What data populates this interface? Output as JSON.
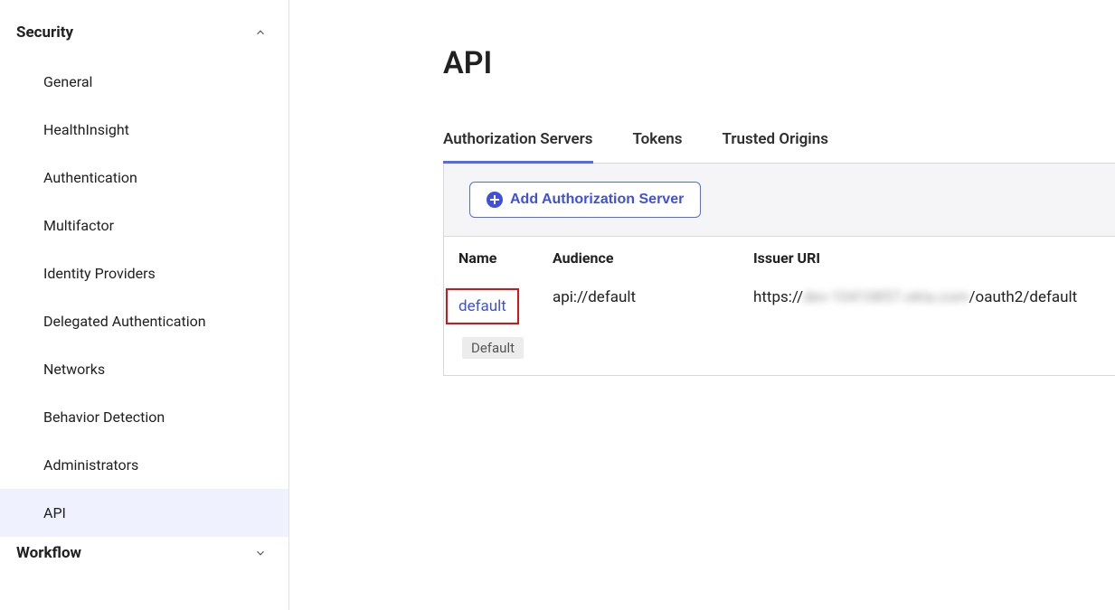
{
  "sidebar": {
    "sections": [
      {
        "label": "Security",
        "expanded": true,
        "items": [
          {
            "label": "General"
          },
          {
            "label": "HealthInsight"
          },
          {
            "label": "Authentication"
          },
          {
            "label": "Multifactor"
          },
          {
            "label": "Identity Providers"
          },
          {
            "label": "Delegated Authentication"
          },
          {
            "label": "Networks"
          },
          {
            "label": "Behavior Detection"
          },
          {
            "label": "Administrators"
          },
          {
            "label": "API",
            "active": true
          }
        ]
      },
      {
        "label": "Workflow",
        "expanded": false
      }
    ]
  },
  "page": {
    "title": "API",
    "tabs": [
      {
        "label": "Authorization Servers",
        "active": true
      },
      {
        "label": "Tokens"
      },
      {
        "label": "Trusted Origins"
      }
    ],
    "add_button_label": "Add Authorization Server",
    "table": {
      "headers": {
        "name": "Name",
        "audience": "Audience",
        "issuer": "Issuer URI"
      },
      "rows": [
        {
          "name": "default",
          "audience": "api://default",
          "issuer_prefix": "https://",
          "issuer_obscured": "dev-10410857.okta.com",
          "issuer_suffix": "/oauth2/default",
          "badge": "Default"
        }
      ]
    }
  }
}
